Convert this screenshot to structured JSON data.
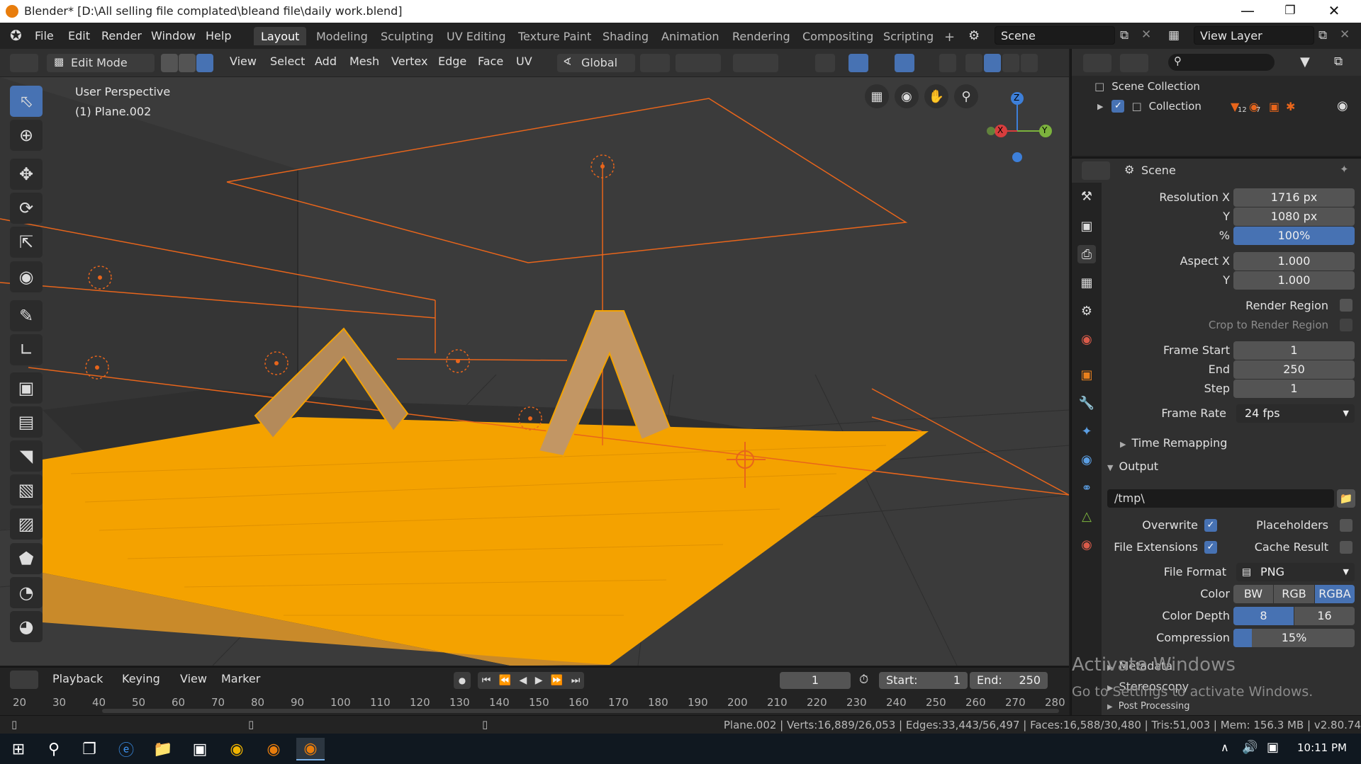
{
  "window": {
    "title": "Blender* [D:\\All selling file complated\\bleand file\\daily work.blend]"
  },
  "menus": [
    "File",
    "Edit",
    "Render",
    "Window",
    "Help"
  ],
  "workspaces": {
    "tabs": [
      "Layout",
      "Modeling",
      "Sculpting",
      "UV Editing",
      "Texture Paint",
      "Shading",
      "Animation",
      "Rendering",
      "Compositing",
      "Scripting"
    ],
    "active": "Layout",
    "add": "+"
  },
  "scene_field": "Scene",
  "view_layer_field": "View Layer",
  "header": {
    "mode": "Edit Mode",
    "menus": [
      "View",
      "Select",
      "Add",
      "Mesh",
      "Vertex",
      "Edge",
      "Face",
      "UV"
    ],
    "orientation": "Global"
  },
  "viewport": {
    "perspective": "User Perspective",
    "object": "(1) Plane.002",
    "gizmo": {
      "z": "Z",
      "y": "Y",
      "x": "X"
    }
  },
  "outliner": {
    "root": "Scene Collection",
    "collection": "Collection",
    "badges": [
      "12",
      "7"
    ]
  },
  "properties": {
    "context": "Scene",
    "resolution_x_label": "Resolution X",
    "resolution_x": "1716 px",
    "y_label": "Y",
    "resolution_y": "1080 px",
    "percent_label": "%",
    "percent": "100%",
    "aspect_x_label": "Aspect X",
    "aspect_x": "1.000",
    "aspect_y": "1.000",
    "render_region": "Render Region",
    "crop": "Crop to Render Region",
    "frame_start_label": "Frame Start",
    "frame_start": "1",
    "end_label": "End",
    "frame_end": "250",
    "step_label": "Step",
    "step": "1",
    "frame_rate_label": "Frame Rate",
    "frame_rate": "24 fps",
    "time_remapping": "Time Remapping",
    "output": "Output",
    "output_path": "/tmp\\",
    "overwrite": "Overwrite",
    "placeholders": "Placeholders",
    "file_extensions": "File Extensions",
    "cache_result": "Cache Result",
    "file_format_label": "File Format",
    "file_format": "PNG",
    "color_label": "Color",
    "color_options": [
      "BW",
      "RGB",
      "RGBA"
    ],
    "color_selected": "RGBA",
    "color_depth_label": "Color Depth",
    "color_depth_options": [
      "8",
      "16"
    ],
    "color_depth_selected": "8",
    "compression_label": "Compression",
    "compression": "15%",
    "compression_fraction": 0.15,
    "metadata": "Metadata",
    "stereoscopy": "Stereoscopy",
    "post_processing": "Post Processing"
  },
  "timeline": {
    "menus": [
      "Playback",
      "Keying",
      "View",
      "Marker"
    ],
    "current_frame": "1",
    "start_label": "Start:",
    "start": "1",
    "end_label": "End:",
    "end": "250",
    "ticks": [
      "20",
      "30",
      "40",
      "50",
      "60",
      "70",
      "80",
      "90",
      "100",
      "110",
      "120",
      "130",
      "140",
      "150",
      "160",
      "170",
      "180",
      "190",
      "200",
      "210",
      "220",
      "230",
      "240",
      "250",
      "260",
      "270",
      "280"
    ]
  },
  "status": "Plane.002 | Verts:16,889/26,053 | Edges:33,443/56,497 | Faces:16,588/30,480 | Tris:51,003 | Mem: 156.3 MB | v2.80.74",
  "watermark": {
    "line1": "Activate Windows",
    "line2": "Go to Settings to activate Windows."
  },
  "taskbar": {
    "time": "10:11 PM"
  },
  "colors": {
    "accent": "#4772b3",
    "selection": "#f4a200",
    "wire": "#e8651b",
    "blender_orange": "#e87d0d"
  }
}
